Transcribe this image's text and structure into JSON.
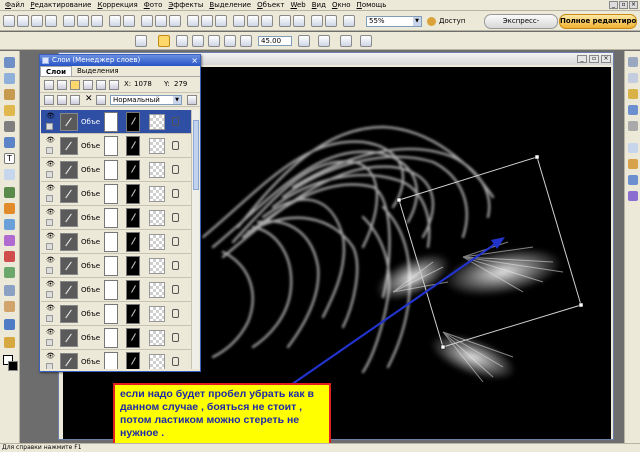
{
  "menu": [
    "Файл",
    "Редактирование",
    "Коррекция",
    "Фото",
    "Эффекты",
    "Выделение",
    "Объект",
    "Web",
    "Вид",
    "Окно",
    "Помощь"
  ],
  "toolbar": {
    "zoom": "55%",
    "access_label": "Доступ",
    "mode_tabs": [
      "Экспресс-коррекция",
      "Полное редактиров..."
    ]
  },
  "options_bar": {
    "angle": "45.00"
  },
  "layers_panel": {
    "title": "Слои (Менеджер слоев)",
    "tabs": [
      "Слои",
      "Выделения"
    ],
    "x_label": "X:",
    "x_value": "1078",
    "y_label": "Y:",
    "y_value": "279",
    "blend_mode": "Нормальный",
    "layer_name": "Объе",
    "layer_count": 11,
    "selected_index": 0
  },
  "annotation": {
    "lines": [
      "если надо будет пробел убрать как в",
      "данном случае , бояться не стоит ,",
      "потом ластиком можно стереть не",
      "нужное ."
    ]
  },
  "status_bar": "Для справки нажмите F1",
  "colors": {
    "ui_bg": "#ece9d8",
    "canvas": "#000000",
    "note_bg": "#ffff00",
    "note_border": "#e02020",
    "note_text": "#1f2aa8",
    "arrow": "#2233cc",
    "selection": "#2f4fa5"
  }
}
